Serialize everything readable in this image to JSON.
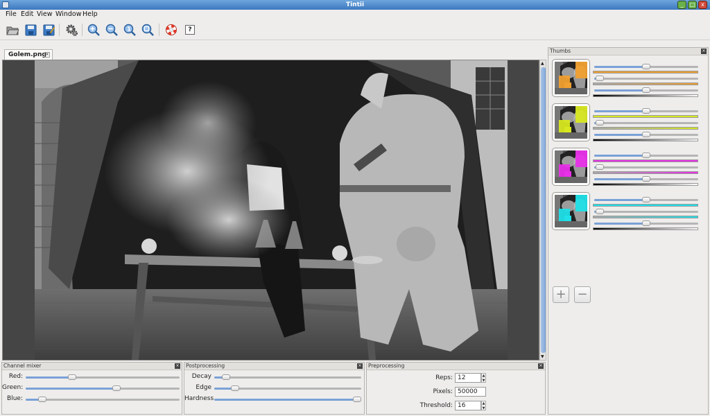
{
  "window": {
    "title": "Tintii"
  },
  "menu": [
    "File",
    "Edit",
    "View",
    "Window",
    "Help"
  ],
  "toolbar": {
    "icons": [
      "open-folder-icon",
      "save-icon",
      "save-as-icon",
      "settings-gear-icon",
      "zoom-in-icon",
      "zoom-out-icon",
      "zoom-actual-size-icon",
      "zoom-fit-icon",
      "help-lifebuoy-icon",
      "about-icon"
    ],
    "about_label": "?"
  },
  "document": {
    "tab_label": "Golem.png",
    "close_glyph": "×"
  },
  "channel_mixer": {
    "title": "Channel mixer",
    "sliders": [
      {
        "label": "Red:",
        "value": 0.3
      },
      {
        "label": "Green:",
        "value": 0.59
      },
      {
        "label": "Blue:",
        "value": 0.11
      }
    ]
  },
  "postprocessing": {
    "title": "Postprocessing",
    "sliders": [
      {
        "label": "Decay",
        "value": 0.08
      },
      {
        "label": "Edge",
        "value": 0.14
      },
      {
        "label": "Hardness",
        "value": 1.0
      }
    ]
  },
  "preprocessing": {
    "title": "Preprocessing",
    "fields": [
      {
        "label": "Reps:",
        "value": "12"
      },
      {
        "label": "Pixels:",
        "value": "50000"
      },
      {
        "label": "Threshold:",
        "value": "16"
      }
    ]
  },
  "thumbs": {
    "title": "Thumbs",
    "items": [
      {
        "color": "#f0a030",
        "hue": 0.5,
        "sat": 0.05,
        "val": 0.5
      },
      {
        "color": "#d8e820",
        "hue": 0.5,
        "sat": 0.05,
        "val": 0.5
      },
      {
        "color": "#e830e8",
        "hue": 0.5,
        "sat": 0.05,
        "val": 0.5
      },
      {
        "color": "#20e0e8",
        "hue": 0.5,
        "sat": 0.05,
        "val": 0.5
      }
    ],
    "add_label": "+",
    "remove_label": "−"
  },
  "colors": {
    "accent": "#7aa1d6",
    "titlebar": "#4a86c8"
  }
}
